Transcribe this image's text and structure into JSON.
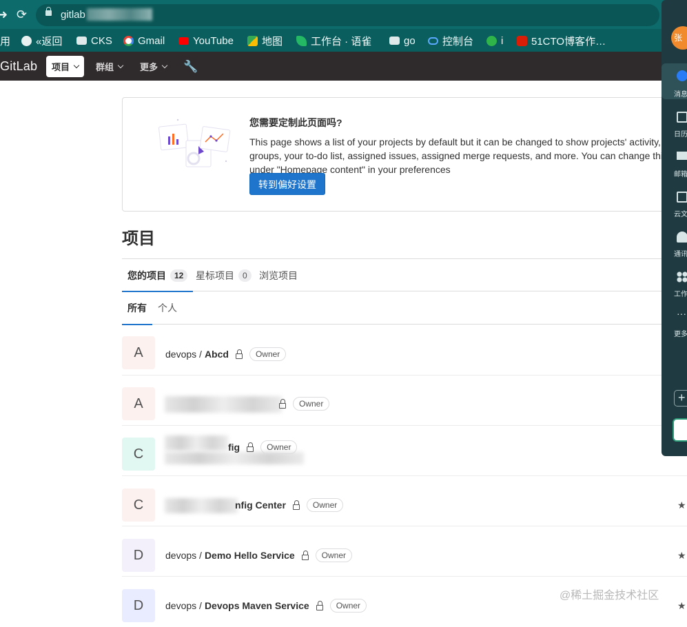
{
  "browser": {
    "url_visible": "gitlab",
    "bookmarks": [
      {
        "label": "用",
        "icon": "apps-icon"
      },
      {
        "label": "«返回",
        "icon": "globe-icon"
      },
      {
        "label": "CKS",
        "icon": "folder-icon"
      },
      {
        "label": "Gmail",
        "icon": "google-icon"
      },
      {
        "label": "YouTube",
        "icon": "youtube-icon"
      },
      {
        "label": "地图",
        "icon": "maps-icon"
      },
      {
        "label": "工作台 · 语雀",
        "icon": "yuque-icon"
      },
      {
        "label": "go",
        "icon": "folder-icon"
      },
      {
        "label": "控制台",
        "icon": "cloud-icon"
      },
      {
        "label": "i",
        "icon": "green-s-icon"
      },
      {
        "label": "51CTO博客作…",
        "icon": "51cto-icon"
      }
    ]
  },
  "gitlab": {
    "logo": "GitLab",
    "nav": {
      "projects": "项目",
      "groups": "群组",
      "more": "更多"
    }
  },
  "callout": {
    "title": "您需要定制此页面吗?",
    "body": "This page shows a list of your projects by default but it can be changed to show projects' activity, groups, your to-do list, assigned issues, assigned merge requests, and more. You can change this under \"Homepage content\" in your preferences",
    "button": "转到偏好设置"
  },
  "page_title": "项目",
  "tabs": [
    {
      "label": "您的项目",
      "count": "12"
    },
    {
      "label": "星标项目",
      "count": "0"
    },
    {
      "label": "浏览项目",
      "count": ""
    }
  ],
  "subtabs": [
    "所有",
    "个人"
  ],
  "projects": [
    {
      "letter": "A",
      "namespace": "devops /",
      "name": "Abcd",
      "role": "Owner",
      "avatar_bg": "#fcf1ef"
    },
    {
      "letter": "A",
      "namespace": "",
      "name": "",
      "role": "Owner",
      "avatar_bg": "#fcf1ef"
    },
    {
      "letter": "C",
      "namespace": "",
      "name": "fig",
      "role": "Owner",
      "avatar_bg": "#e1f7f2"
    },
    {
      "letter": "C",
      "namespace": "",
      "name": "nfig Center",
      "role": "Owner",
      "avatar_bg": "#fcf1ef"
    },
    {
      "letter": "D",
      "namespace": "devops /",
      "name": "Demo Hello Service",
      "role": "Owner",
      "avatar_bg": "#f4f0fb"
    },
    {
      "letter": "D",
      "namespace": "devops /",
      "name": "Devops Maven Service",
      "role": "Owner",
      "avatar_bg": "#e9ebff"
    }
  ],
  "side_panel": {
    "avatar": "张",
    "items": [
      "消息",
      "日历",
      "邮箱",
      "云文档",
      "通讯录",
      "工作台",
      "更多"
    ]
  },
  "watermark": "@稀土掘金技术社区"
}
